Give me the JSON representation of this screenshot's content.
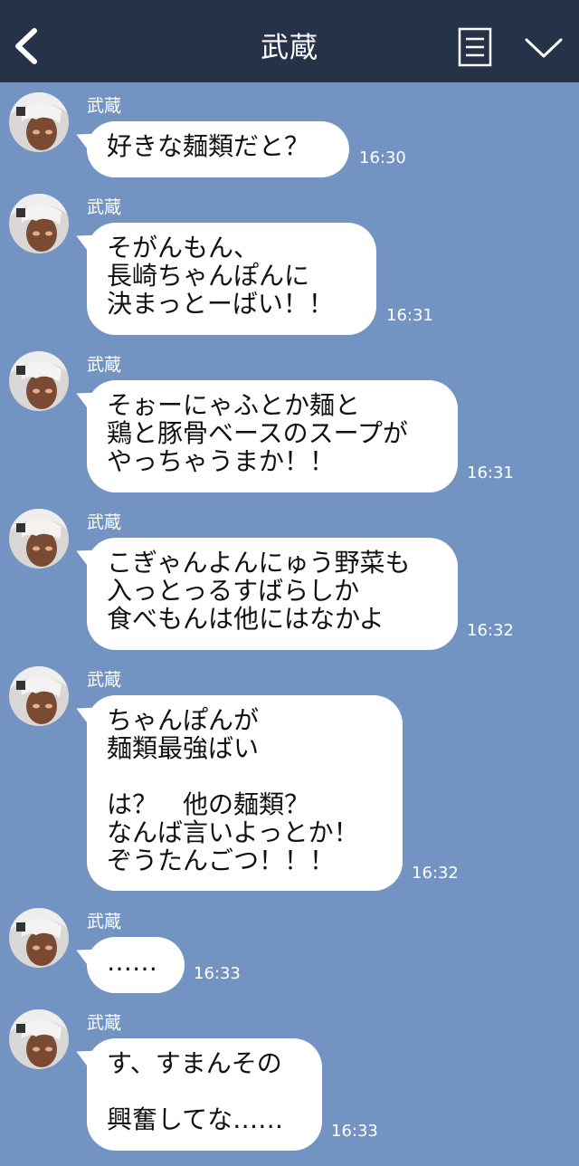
{
  "header": {
    "title": "武蔵",
    "back_icon": "back-arrow-icon",
    "menu_icon": "menu-list-icon",
    "collapse_icon": "chevron-down-icon",
    "bg_color": "#263248"
  },
  "chat": {
    "bg_color": "#7393c2",
    "bubble_color": "#ffffff",
    "messages": [
      {
        "sender": "武蔵",
        "text": "好きな麺類だと？",
        "time": "16:30"
      },
      {
        "sender": "武蔵",
        "text": "そがんもん、\n長崎ちゃんぽんに\n決まっとーばい！！",
        "time": "16:31"
      },
      {
        "sender": "武蔵",
        "text": "そぉーにゃふとか麺と\n鶏と豚骨ベースのスープが\nやっちゃうまか！！",
        "time": "16:31"
      },
      {
        "sender": "武蔵",
        "text": "こぎゃんよんにゅう野菜も\n入っとっるすばらしか\n食べもんは他にはなかよ",
        "time": "16:32"
      },
      {
        "sender": "武蔵",
        "text": "ちゃんぽんが\n麺類最強ばい\n\nは？　他の麺類？\nなんば言いよっとか！\nぞうたんごつ！！！",
        "time": "16:32"
      },
      {
        "sender": "武蔵",
        "text": "……",
        "time": "16:33"
      },
      {
        "sender": "武蔵",
        "text": "す、すまんその\n\n興奮してな……",
        "time": "16:33"
      }
    ]
  }
}
